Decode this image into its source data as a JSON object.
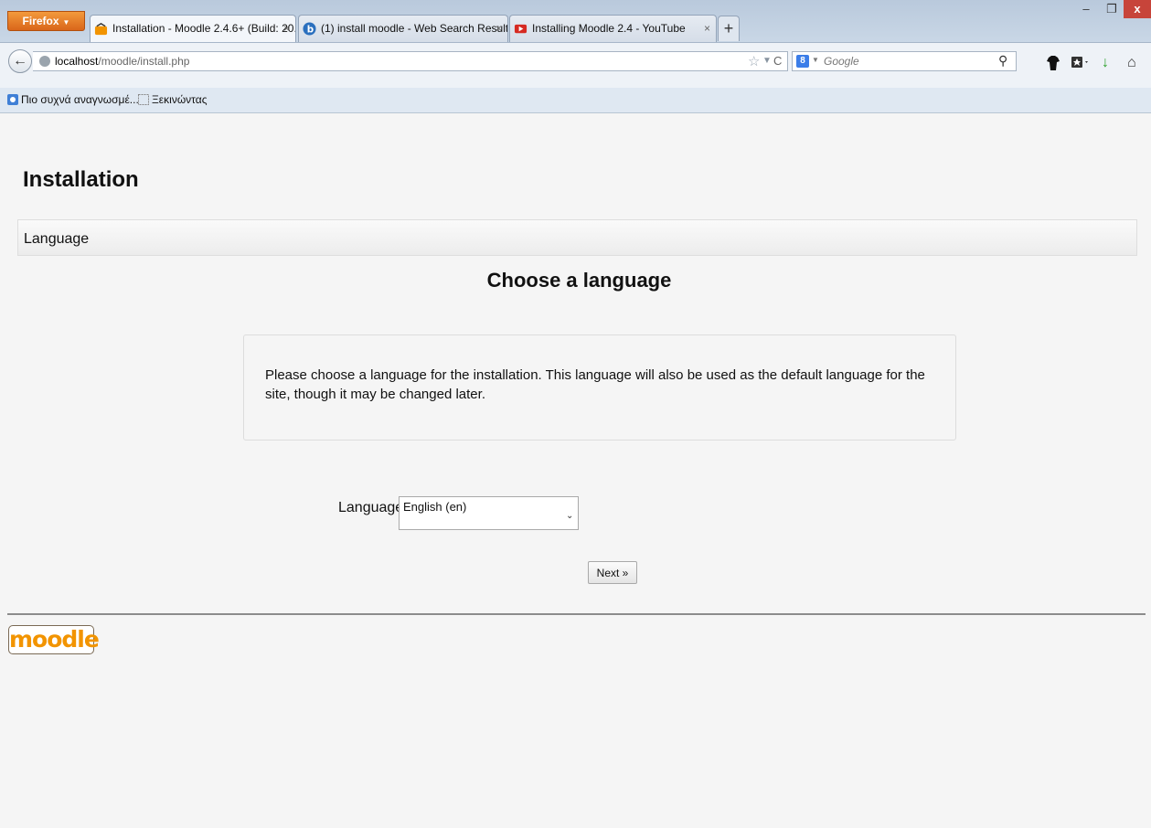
{
  "browser": {
    "menu_button": "Firefox",
    "tabs": [
      {
        "title": "Installation - Moodle 2.4.6+ (Build: 20...",
        "active": true,
        "favicon": "moodle-icon"
      },
      {
        "title": "(1) install moodle - Web Search Results",
        "active": false,
        "favicon": "bing-icon"
      },
      {
        "title": "Installing Moodle 2.4 - YouTube",
        "active": false,
        "favicon": "youtube-icon"
      }
    ],
    "new_tab": "+",
    "url_host": "localhost",
    "url_path": "/moodle/install.php",
    "search_placeholder": "Google",
    "bookmarks": [
      {
        "label": "Πιο συχνά αναγνωσμέ...",
        "icon": "bookmark-blue-icon"
      },
      {
        "label": "Ξεκινώντας",
        "icon": "bookmark-folder-icon"
      }
    ]
  },
  "page": {
    "title": "Installation",
    "section": "Language",
    "heading": "Choose a language",
    "info": "Please choose a language for the installation. This language will also be used as the default language for the site, though it may be changed later.",
    "language_label": "Language",
    "language_selected": "English (en)",
    "next_button": "Next »",
    "logo_text": "moodle"
  },
  "colors": {
    "moodle_orange": "#f29400",
    "firefox_orange": "#e67e22",
    "close_red": "#c7443a"
  }
}
